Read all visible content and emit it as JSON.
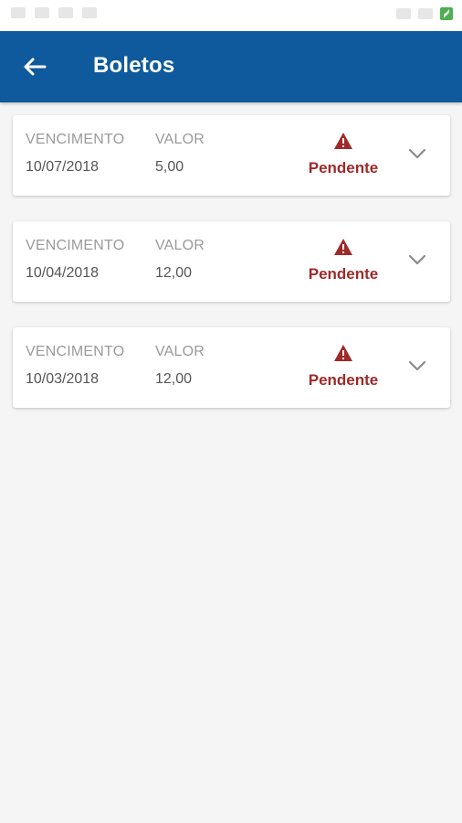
{
  "app_bar": {
    "title": "Boletos"
  },
  "labels": {
    "vencimento": "VENCIMENTO",
    "valor": "VALOR"
  },
  "boletos": [
    {
      "vencimento": "10/07/2018",
      "valor": "5,00",
      "status": "Pendente"
    },
    {
      "vencimento": "10/04/2018",
      "valor": "12,00",
      "status": "Pendente"
    },
    {
      "vencimento": "10/03/2018",
      "valor": "12,00",
      "status": "Pendente"
    }
  ],
  "colors": {
    "primary": "#0f5a9c",
    "pending": "#9e2a2a",
    "background": "#f5f5f5"
  },
  "icons": {
    "back": "arrow-left-icon",
    "status": "warning-icon",
    "expand": "chevron-down-icon"
  }
}
